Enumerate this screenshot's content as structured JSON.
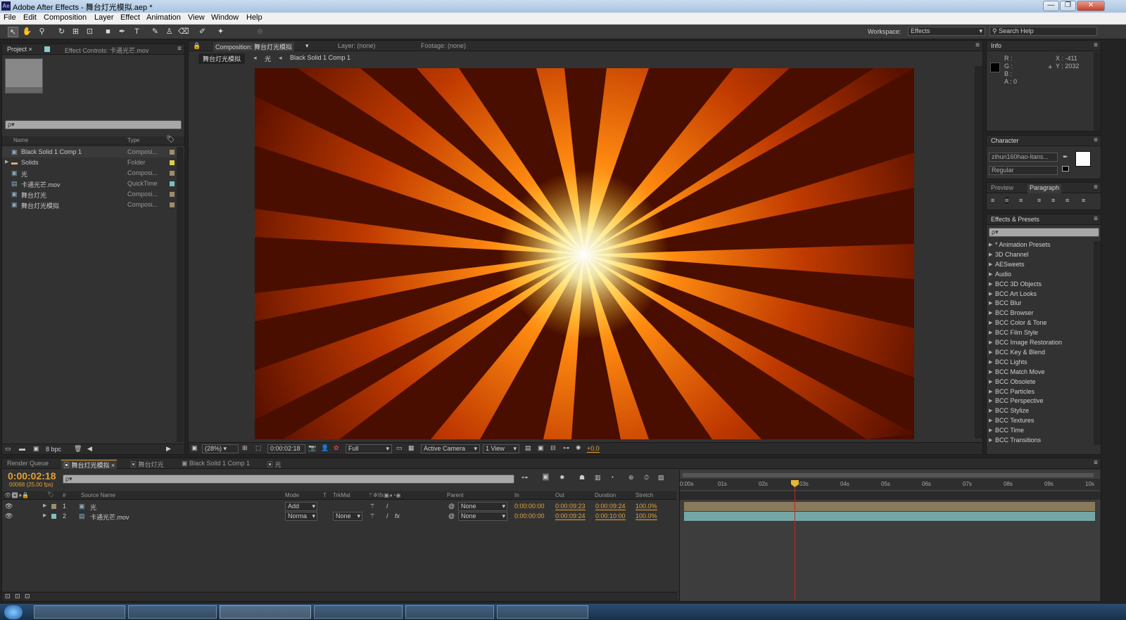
{
  "window": {
    "title": "Adobe After Effects - 舞台灯光模拟.aep *",
    "app_badge": "Ae",
    "min": "—",
    "max": "❐",
    "close": "✕"
  },
  "menu": [
    "File",
    "Edit",
    "Composition",
    "Layer",
    "Effect",
    "Animation",
    "View",
    "Window",
    "Help"
  ],
  "toolbar": {
    "workspace_label": "Workspace:",
    "workspace_value": "Effects",
    "search_help": "Search Help"
  },
  "project": {
    "tab_project": "Project ×",
    "tab_effect_controls": "Effect Controls: 卡通光芒.mov",
    "search_placeholder": "ρ▾",
    "col_name": "Name",
    "col_type": "Type",
    "items": [
      {
        "name": "Black Solid 1 Comp 1",
        "type": "Composi...",
        "color": "#9e8c6e"
      },
      {
        "name": "Solids",
        "type": "Folder",
        "color": "#e0cd4a"
      },
      {
        "name": "光",
        "type": "Composi...",
        "color": "#9e8c6e"
      },
      {
        "name": "卡通光芒.mov",
        "type": "QuickTime",
        "color": "#7fbfc2"
      },
      {
        "name": "舞台灯光",
        "type": "Composi...",
        "color": "#9e8c6e"
      },
      {
        "name": "舞台灯光模拟",
        "type": "Composi...",
        "color": "#9e8c6e"
      }
    ],
    "bpc": "8 bpc"
  },
  "comp": {
    "tab_comp": "Composition: 舞台灯光模拟",
    "tab_layer": "Layer: (none)",
    "tab_footage": "Footage: (none)",
    "breadcrumb": [
      "舞台灯光模拟",
      "光",
      "Black Solid 1 Comp 1"
    ],
    "zoom": "(28%)",
    "timecode": "0:00:02:18",
    "resolution": "Full",
    "camera": "Active Camera",
    "views": "1 View",
    "exposure": "+0.0"
  },
  "info": {
    "tab": "Info",
    "r": "R :",
    "g": "G :",
    "b": "B :",
    "a": "A : 0",
    "x": "X : -411",
    "y": "Y : 2032"
  },
  "character": {
    "tab": "Character",
    "font": "zihun160hao-itans...",
    "style": "Regular"
  },
  "preview_tab": "Preview",
  "paragraph_tab": "Paragraph",
  "effects": {
    "tab": "Effects & Presets",
    "search": "ρ▾",
    "items": [
      "* Animation Presets",
      "3D Channel",
      "AESweets",
      "Audio",
      "BCC 3D Objects",
      "BCC Art Looks",
      "BCC Blur",
      "BCC Browser",
      "BCC Color & Tone",
      "BCC Film Style",
      "BCC Image Restoration",
      "BCC Key & Blend",
      "BCC Lights",
      "BCC Match Move",
      "BCC Obsolete",
      "BCC Particles",
      "BCC Perspective",
      "BCC Stylize",
      "BCC Textures",
      "BCC Time",
      "BCC Transitions"
    ]
  },
  "timeline": {
    "tabs": [
      "Render Queue",
      "舞台灯光模拟",
      "舞台灯光",
      "Black Solid 1 Comp 1",
      "光"
    ],
    "timecode": "0:00:02:18",
    "frames": "00068 (25.00 fps)",
    "search": "ρ▾",
    "headers": {
      "num": "#",
      "source": "Source Name",
      "mode": "Mode",
      "t": "T",
      "trkmat": "TrkMat",
      "parent": "Parent",
      "in": "In",
      "out": "Out",
      "duration": "Duration",
      "stretch": "Stretch"
    },
    "layers": [
      {
        "num": "1",
        "name": "光",
        "mode": "Add",
        "trkmat": "",
        "parent": "None",
        "in": "0:00:00:00",
        "out": "0:00:09:23",
        "duration": "0:00:09:24",
        "stretch": "100.0%",
        "color": "#9e8c6e",
        "bar": "#8a7a5c"
      },
      {
        "num": "2",
        "name": "卡通光芒.mov",
        "mode": "Norma",
        "trkmat": "None",
        "parent": "None",
        "in": "0:00:00:00",
        "out": "0:00:09:24",
        "duration": "0:00:10:00",
        "stretch": "100.0%",
        "color": "#7fbfc2",
        "bar": "#74a6a6"
      }
    ],
    "ruler": [
      "0:00s",
      "01s",
      "02s",
      "03s",
      "04s",
      "05s",
      "06s",
      "07s",
      "08s",
      "09s",
      "10s"
    ]
  },
  "colors": {
    "accent_orange": "#e4a236",
    "panel_bg": "#323232",
    "playhead": "#cc2222"
  }
}
